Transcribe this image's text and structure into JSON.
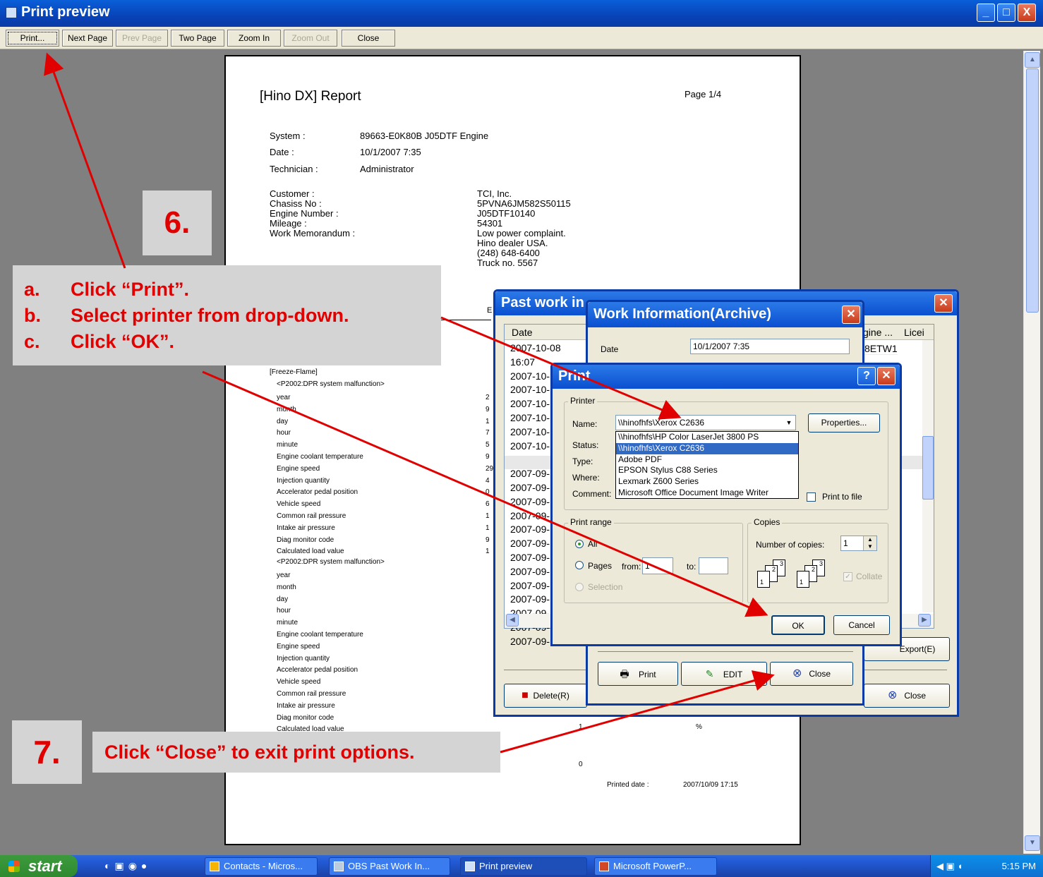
{
  "window": {
    "title": "Print preview",
    "controls": [
      "_",
      "□",
      "X"
    ]
  },
  "toolbar": {
    "buttons": [
      {
        "label": "Print...",
        "enabled": true
      },
      {
        "label": "Next Page",
        "enabled": true
      },
      {
        "label": "Prev Page",
        "enabled": false
      },
      {
        "label": "Two Page",
        "enabled": true
      },
      {
        "label": "Zoom In",
        "enabled": true
      },
      {
        "label": "Zoom Out",
        "enabled": false
      },
      {
        "label": "Close",
        "enabled": true
      }
    ]
  },
  "report": {
    "title": "[Hino DX] Report",
    "page": "Page 1/4",
    "system_label": "System :",
    "system_value": "89663-E0K80B J05DTF Engine",
    "date_label": "Date :",
    "date_value": "10/1/2007 7:35",
    "tech_label": "Technician :",
    "tech_value": "Administrator",
    "customer_labels": [
      "Customer :",
      "Chasiss No :",
      "Engine Number :",
      "Mileage :",
      "Work Memorandum :"
    ],
    "customer_values": [
      "TCI, Inc.",
      "5PVNA6JM582S50115",
      "J05DTF10140",
      "54301",
      "Low power complaint.",
      "Hino dealer USA.",
      "(248) 648-6400",
      "Truck no. 5567"
    ],
    "freeze_header": "[Freeze-Flame]",
    "dtc1": "<P2002:DPR system malfunction>",
    "dtc2": "<P2002:DPR system malfunction>",
    "params": [
      "year",
      "month",
      "day",
      "hour",
      "minute",
      "Engine coolant temperature",
      "Engine speed",
      "Injection quantity",
      "Accelerator pedal position",
      "Vehicle speed",
      "Common rail pressure",
      "Intake air pressure",
      "Diag monitor code",
      "Calculated load value"
    ],
    "frag_chars": [
      "2",
      "9",
      "1",
      "7",
      "5",
      "9",
      "29",
      "4",
      "0",
      "6",
      "1",
      "1",
      "9",
      "1"
    ],
    "last_value": "1",
    "last_unit": "%",
    "zero_value": "0",
    "printed_label": "Printed date :",
    "printed_value": "2007/10/09 17:15",
    "header_fragment": "E"
  },
  "past_work": {
    "title": "Past work in",
    "columns": [
      "Date",
      "gine ...",
      "Licei"
    ],
    "rows": [
      "2007-10-08 16:07",
      "2007-10-",
      "2007-10-",
      "2007-10-",
      "2007-10-",
      "2007-10-",
      "2007-10-",
      "2007-09-",
      "2007-09-",
      "2007-09-",
      "2007-09-",
      "2007-09-",
      "2007-09-",
      "2007-09-",
      "2007-09-",
      "2007-09-",
      "2007-09-",
      "2007-09-",
      "2007-09-",
      "2007-09-",
      "2007-09-"
    ],
    "engine_first": "8ETW1",
    "delete_label": "Delete(R)",
    "export_label": "Export(E)",
    "close_label": "Close"
  },
  "archive": {
    "title": "Work Information(Archive)",
    "date_label": "Date",
    "date_value": "10/1/2007 7:35",
    "print_label": "Print",
    "edit_label": "EDIT",
    "close_label": "Close"
  },
  "print_dialog": {
    "title": "Print",
    "help": "?",
    "printer_group": "Printer",
    "name_label": "Name:",
    "name_value": "\\\\hinofhfs\\Xerox C2636",
    "printers": [
      "\\\\hinofhfs\\HP Color LaserJet 3800 PS",
      "\\\\hinofhfs\\Xerox C2636",
      "Adobe PDF",
      "EPSON Stylus C88 Series",
      "Lexmark Z600 Series",
      "Microsoft Office Document Image Writer"
    ],
    "selected_index": 1,
    "status_label": "Status:",
    "type_label": "Type:",
    "where_label": "Where:",
    "comment_label": "Comment:",
    "properties_label": "Properties...",
    "print_to_file": "Print to file",
    "range_group": "Print range",
    "all_label": "All",
    "pages_label": "Pages",
    "from_label": "from:",
    "from_value": "1",
    "to_label": "to:",
    "selection_label": "Selection",
    "copies_group": "Copies",
    "num_copies_label": "Number of copies:",
    "num_copies_value": "1",
    "collate_label": "Collate",
    "ok_label": "OK",
    "cancel_label": "Cancel"
  },
  "annotations": {
    "step6": "6.",
    "step6_lines": [
      {
        "letter": "a.",
        "text": "Click “Print”."
      },
      {
        "letter": "b.",
        "text": "Select printer from drop-down."
      },
      {
        "letter": "c.",
        "text": "Click “OK”."
      }
    ],
    "step7": "7.",
    "step7_text": "Click “Close” to exit print options.",
    "arrow_color": "#e10000"
  },
  "taskbar": {
    "start": "start",
    "tasks": [
      "Contacts - Micros...",
      "OBS Past Work In...",
      "Print preview",
      "Microsoft PowerP..."
    ],
    "active_index": 2,
    "clock": "5:15 PM"
  }
}
